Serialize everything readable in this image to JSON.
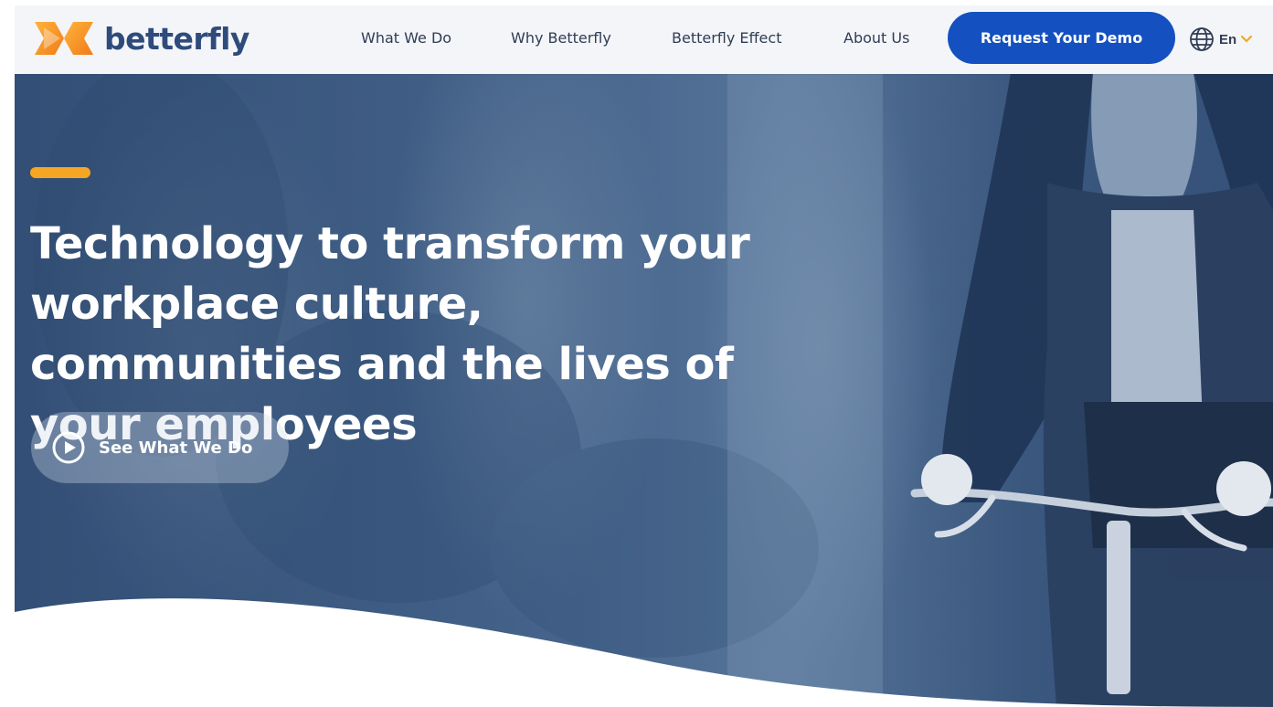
{
  "brand": {
    "name": "betterfly",
    "primary_color": "#1450c0",
    "accent_color": "#f5a623",
    "logo_icon": "butterfly-logo-icon"
  },
  "nav": {
    "items": [
      {
        "label": "What We Do"
      },
      {
        "label": "Why Betterfly"
      },
      {
        "label": "Betterfly Effect"
      },
      {
        "label": "About Us"
      }
    ],
    "cta_label": "Request Your Demo",
    "language": {
      "label": "En",
      "icon": "globe-icon"
    }
  },
  "hero": {
    "headline": "Technology to transform your workplace culture, communities and the lives of your employees",
    "cta_label": "See What We Do",
    "cta_icon": "play-circle-icon"
  }
}
